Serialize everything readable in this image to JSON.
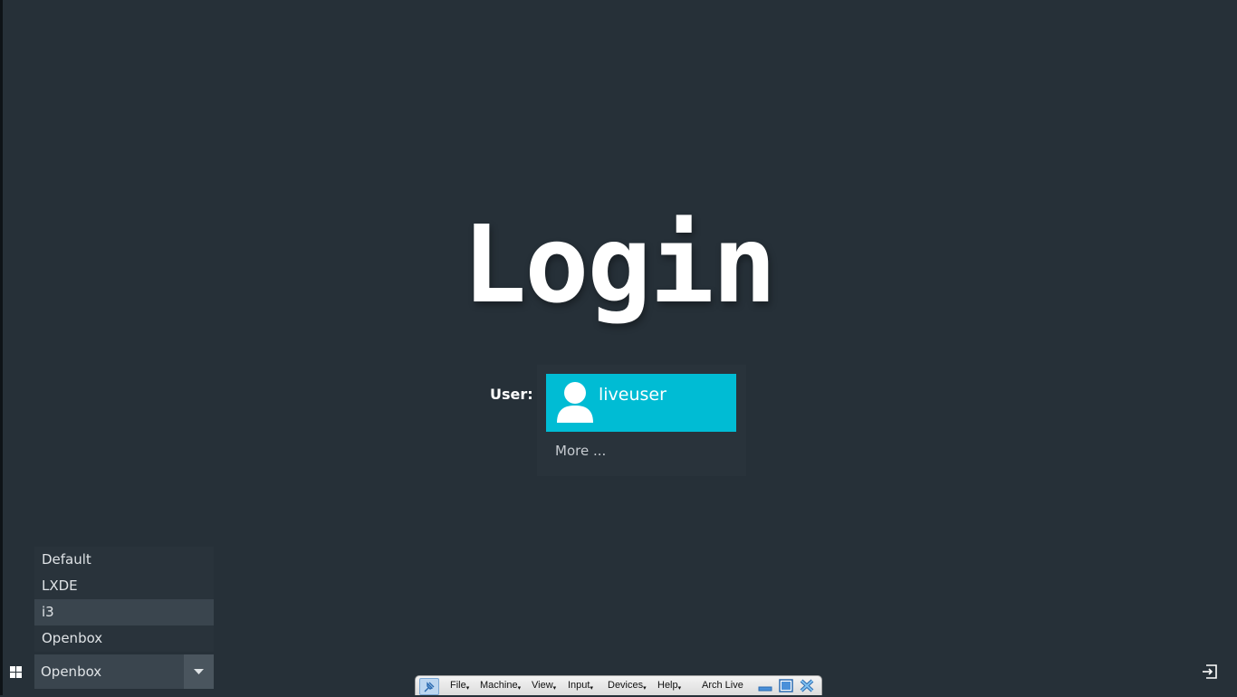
{
  "greeter": {
    "title": "Login",
    "user_label": "User:",
    "users": [
      {
        "name": "liveuser",
        "icon": "user-avatar-icon"
      }
    ],
    "more_label": "More ...",
    "accent_color": "#00bcd4"
  },
  "session": {
    "options": [
      "Default",
      "LXDE",
      "i3",
      "Openbox"
    ],
    "hovered": "i3",
    "selected": "Openbox"
  },
  "vbox_toolbar": {
    "menus": [
      "File",
      "Machine",
      "View",
      "Input",
      "Devices",
      "Help"
    ],
    "vm_name": "Arch Live"
  }
}
